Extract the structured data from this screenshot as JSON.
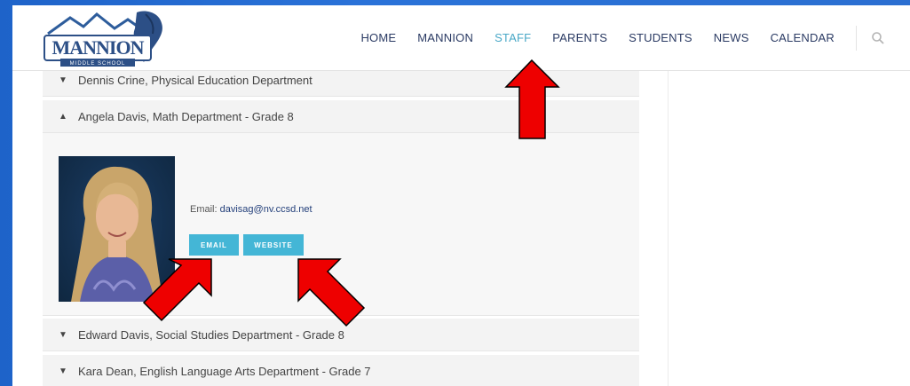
{
  "site": {
    "logo_text": "MANNION",
    "logo_sub": "MIDDLE SCHOOL"
  },
  "nav": {
    "items": [
      {
        "label": "HOME"
      },
      {
        "label": "MANNION"
      },
      {
        "label": "STAFF"
      },
      {
        "label": "PARENTS"
      },
      {
        "label": "STUDENTS"
      },
      {
        "label": "NEWS"
      },
      {
        "label": "CALENDAR"
      }
    ],
    "search_icon": "search-icon"
  },
  "staff": {
    "rows": [
      {
        "label": "Dennis Crine, Physical Education Department"
      },
      {
        "label": "Angela Davis, Math Department - Grade 8"
      },
      {
        "label": "Edward Davis, Social Studies Department - Grade 8"
      },
      {
        "label": "Kara Dean, English Language Arts Department - Grade 7"
      }
    ],
    "expanded": {
      "email_label": "Email: ",
      "email_value": "davisag@nv.ccsd.net",
      "email_button": "EMAIL",
      "website_button": "WEBSITE"
    }
  },
  "colors": {
    "accent": "#44b6d6",
    "nav_active": "#4aa8c7",
    "nav": "#2a3a63",
    "arrow": "#ee0000"
  }
}
